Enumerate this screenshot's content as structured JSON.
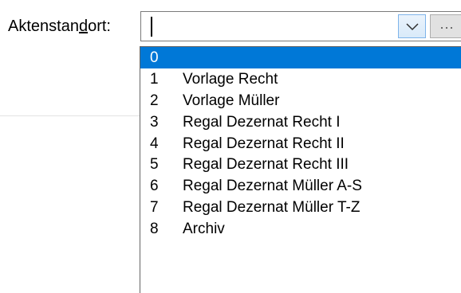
{
  "field": {
    "label_before": "Aktenstan",
    "label_mnemonic": "d",
    "label_after": "ort:",
    "value": ""
  },
  "buttons": {
    "browse_label": "..."
  },
  "icons": {
    "dropdown": "chevron-down-icon"
  },
  "colors": {
    "selection": "#0078d7",
    "dropdown_button_border": "#7eb4ea"
  },
  "dropdown": {
    "selected_index": 0,
    "items": [
      {
        "num": "0",
        "text": ""
      },
      {
        "num": "1",
        "text": "Vorlage Recht"
      },
      {
        "num": "2",
        "text": "Vorlage Müller"
      },
      {
        "num": "3",
        "text": "Regal Dezernat Recht I"
      },
      {
        "num": "4",
        "text": "Regal Dezernat Recht II"
      },
      {
        "num": "5",
        "text": "Regal Dezernat Recht III"
      },
      {
        "num": "6",
        "text": "Regal Dezernat Müller A-S"
      },
      {
        "num": "7",
        "text": "Regal Dezernat Müller T-Z"
      },
      {
        "num": "8",
        "text": "Archiv"
      }
    ]
  }
}
